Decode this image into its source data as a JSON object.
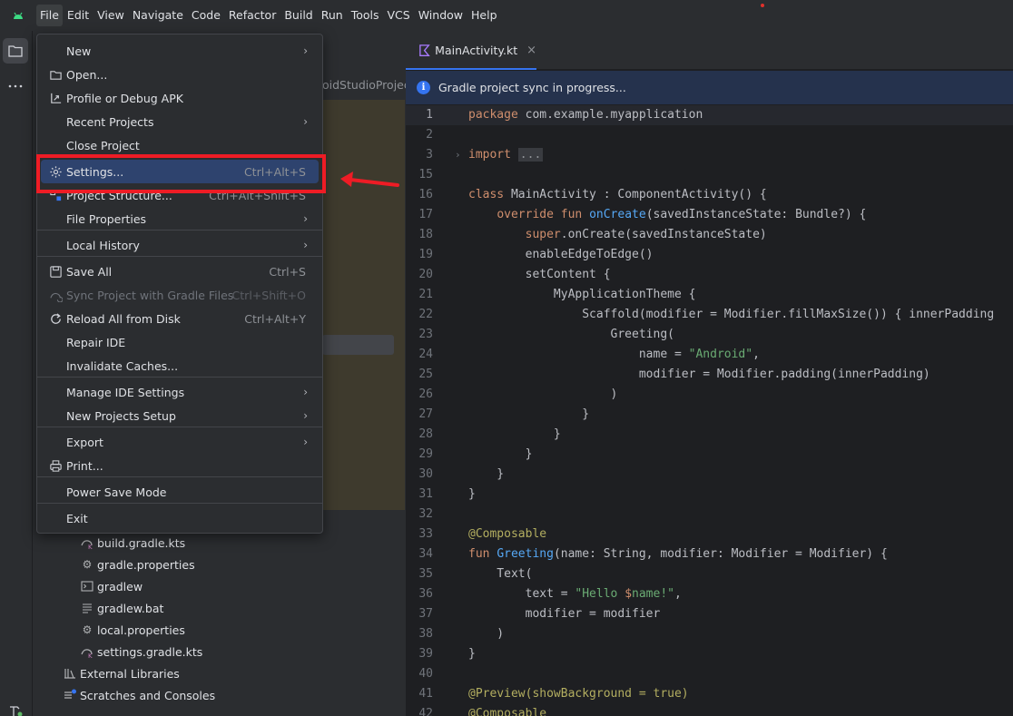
{
  "menubar": {
    "items": [
      "File",
      "Edit",
      "View",
      "Navigate",
      "Code",
      "Refactor",
      "Build",
      "Run",
      "Tools",
      "VCS",
      "Window",
      "Help"
    ]
  },
  "project_panel": {
    "path_fragment": "oidStudioProjects",
    "tree": [
      {
        "label": "build.gradle.kts",
        "icon": "gradle-icon"
      },
      {
        "label": "gradle.properties",
        "icon": "settings-file-icon"
      },
      {
        "label": "gradlew",
        "icon": "terminal-file-icon"
      },
      {
        "label": "gradlew.bat",
        "icon": "text-file-icon"
      },
      {
        "label": "local.properties",
        "icon": "settings-file-icon"
      },
      {
        "label": "settings.gradle.kts",
        "icon": "gradle-icon"
      },
      {
        "label": "External Libraries",
        "icon": "library-icon"
      },
      {
        "label": "Scratches and Consoles",
        "icon": "scratches-icon"
      }
    ]
  },
  "editor": {
    "tab": {
      "label": "MainActivity.kt",
      "close": "×"
    },
    "notice": "Gradle project sync in progress...",
    "lines": [
      {
        "n": "1",
        "text": "package com.example.myapplication"
      },
      {
        "n": "2",
        "text": ""
      },
      {
        "n": "3",
        "text": "import ..."
      },
      {
        "n": "15",
        "text": ""
      },
      {
        "n": "16",
        "text": "class MainActivity : ComponentActivity() {"
      },
      {
        "n": "17",
        "text": "    override fun onCreate(savedInstanceState: Bundle?) {"
      },
      {
        "n": "18",
        "text": "        super.onCreate(savedInstanceState)"
      },
      {
        "n": "19",
        "text": "        enableEdgeToEdge()"
      },
      {
        "n": "20",
        "text": "        setContent {"
      },
      {
        "n": "21",
        "text": "            MyApplicationTheme {"
      },
      {
        "n": "22",
        "text": "                Scaffold(modifier = Modifier.fillMaxSize()) { innerPadding"
      },
      {
        "n": "23",
        "text": "                    Greeting("
      },
      {
        "n": "24",
        "text": "                        name = \"Android\","
      },
      {
        "n": "25",
        "text": "                        modifier = Modifier.padding(innerPadding)"
      },
      {
        "n": "26",
        "text": "                    )"
      },
      {
        "n": "27",
        "text": "                }"
      },
      {
        "n": "28",
        "text": "            }"
      },
      {
        "n": "29",
        "text": "        }"
      },
      {
        "n": "30",
        "text": "    }"
      },
      {
        "n": "31",
        "text": "}"
      },
      {
        "n": "32",
        "text": ""
      },
      {
        "n": "33",
        "text": "@Composable"
      },
      {
        "n": "34",
        "text": "fun Greeting(name: String, modifier: Modifier = Modifier) {"
      },
      {
        "n": "35",
        "text": "    Text("
      },
      {
        "n": "36",
        "text": "        text = \"Hello $name!\","
      },
      {
        "n": "37",
        "text": "        modifier = modifier"
      },
      {
        "n": "38",
        "text": "    )"
      },
      {
        "n": "39",
        "text": "}"
      },
      {
        "n": "40",
        "text": ""
      },
      {
        "n": "41",
        "text": "@Preview(showBackground = true)"
      },
      {
        "n": "42",
        "text": "@Composable"
      }
    ]
  },
  "file_menu": {
    "items": [
      {
        "label": "New",
        "submenu": true
      },
      {
        "label": "Open...",
        "icon": "folder-icon"
      },
      {
        "label": "Profile or Debug APK",
        "icon": "profile-apk-icon"
      },
      {
        "label": "Recent Projects",
        "submenu": true
      },
      {
        "label": "Close Project"
      },
      {
        "label": "Settings...",
        "shortcut": "Ctrl+Alt+S",
        "icon": "gear-icon"
      },
      {
        "label": "Project Structure...",
        "shortcut": "Ctrl+Alt+Shift+S",
        "icon": "project-structure-icon"
      },
      {
        "label": "File Properties",
        "submenu": true
      },
      {
        "label": "Local History",
        "submenu": true
      },
      {
        "label": "Save All",
        "shortcut": "Ctrl+S",
        "icon": "save-icon"
      },
      {
        "label": "Sync Project with Gradle Files",
        "shortcut": "Ctrl+Shift+O",
        "icon": "gradle-sync-icon",
        "disabled": true
      },
      {
        "label": "Reload All from Disk",
        "shortcut": "Ctrl+Alt+Y",
        "icon": "reload-icon"
      },
      {
        "label": "Repair IDE"
      },
      {
        "label": "Invalidate Caches..."
      },
      {
        "label": "Manage IDE Settings",
        "submenu": true
      },
      {
        "label": "New Projects Setup",
        "submenu": true
      },
      {
        "label": "Export",
        "submenu": true
      },
      {
        "label": "Print...",
        "icon": "print-icon"
      },
      {
        "label": "Power Save Mode"
      },
      {
        "label": "Exit"
      }
    ]
  },
  "colors": {
    "highlight": "#2e436e",
    "annotation_red": "#ee1c25",
    "accent_blue": "#3574f0"
  }
}
